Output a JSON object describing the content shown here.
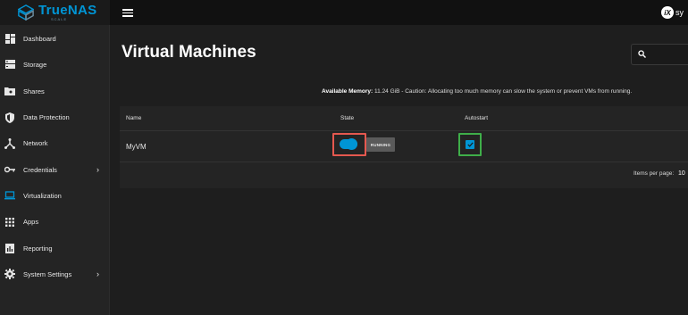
{
  "brand": {
    "name": "TrueNAS",
    "edition": "SCALE",
    "vendor_mark": "iX",
    "vendor_text": "sy"
  },
  "colors": {
    "accent": "#0095d5",
    "state_highlight": "#e5584f",
    "autostart_highlight": "#3fae49"
  },
  "sidebar": {
    "items": [
      {
        "label": "Dashboard",
        "icon": "dashboard-icon"
      },
      {
        "label": "Storage",
        "icon": "storage-icon"
      },
      {
        "label": "Shares",
        "icon": "folder-share-icon"
      },
      {
        "label": "Data Protection",
        "icon": "shield-icon"
      },
      {
        "label": "Network",
        "icon": "network-icon"
      },
      {
        "label": "Credentials",
        "icon": "key-icon",
        "expandable": true
      },
      {
        "label": "Virtualization",
        "icon": "laptop-icon",
        "active": true
      },
      {
        "label": "Apps",
        "icon": "apps-grid-icon"
      },
      {
        "label": "Reporting",
        "icon": "chart-icon"
      },
      {
        "label": "System Settings",
        "icon": "gear-icon",
        "expandable": true
      }
    ]
  },
  "page": {
    "title": "Virtual Machines"
  },
  "memory_note": {
    "label": "Available Memory:",
    "text": " 11.24 GiB - Caution: Allocating too much memory can slow the system or prevent VMs from running."
  },
  "table": {
    "columns": [
      "Name",
      "State",
      "Autostart"
    ],
    "rows": [
      {
        "name": "MyVM",
        "state_on": true,
        "state_label": "RUNNING",
        "autostart": true
      }
    ]
  },
  "pagination": {
    "label": "Items per page:",
    "value": "10"
  }
}
